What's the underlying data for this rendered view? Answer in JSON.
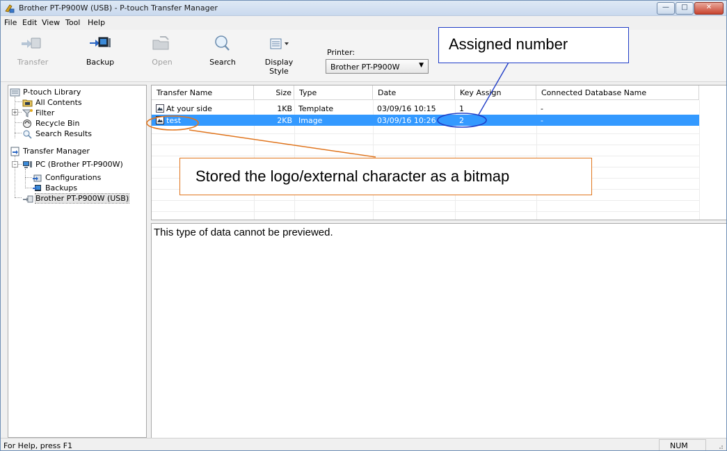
{
  "window": {
    "title": "Brother PT-P900W (USB) - P-touch Transfer Manager"
  },
  "menu": [
    "File",
    "Edit",
    "View",
    "Tool",
    "Help"
  ],
  "toolbar": {
    "transfer": "Transfer",
    "backup": "Backup",
    "open": "Open",
    "search": "Search",
    "display_style": "Display Style",
    "printer_label": "Printer:",
    "printer_value": "Brother PT-P900W"
  },
  "tree": {
    "library": "P-touch Library",
    "all_contents": "All Contents",
    "filter": "Filter",
    "recycle_bin": "Recycle Bin",
    "search_results": "Search Results",
    "transfer_manager": "Transfer Manager",
    "pc": "PC (Brother PT-P900W)",
    "configurations": "Configurations",
    "backups": "Backups",
    "device": "Brother PT-P900W (USB)"
  },
  "list": {
    "columns": [
      "Transfer Name",
      "Size",
      "Type",
      "Date",
      "Key Assign",
      "Connected Database Name"
    ],
    "rows": [
      {
        "name": "At your side",
        "size": "1KB",
        "type": "Template",
        "date": "03/09/16 10:15",
        "key": "1",
        "db": "-"
      },
      {
        "name": "test",
        "size": "2KB",
        "type": "Image",
        "date": "03/09/16 10:26",
        "key": "2",
        "db": "-"
      }
    ]
  },
  "preview": {
    "message": "This type of data cannot be previewed."
  },
  "status": {
    "help": "For Help, press F1",
    "num": "NUM"
  },
  "annotations": {
    "assigned_number": "Assigned number",
    "stored_bitmap": "Stored the logo/external character as a bitmap"
  },
  "colors": {
    "selection": "#3399ff",
    "callout_blue": "#1f3cc7",
    "callout_orange": "#e0741c"
  }
}
